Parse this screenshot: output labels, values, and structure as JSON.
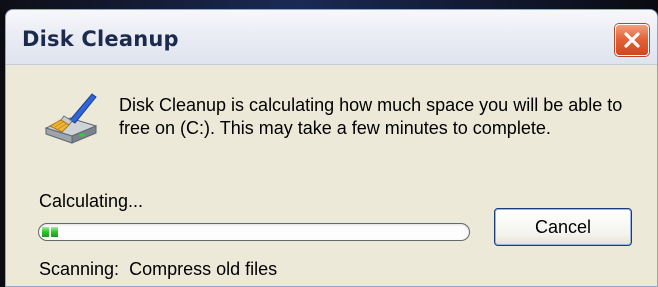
{
  "window": {
    "title": "Disk Cleanup",
    "close_icon": "close-icon"
  },
  "dialog": {
    "icon": "disk-cleanup-brush-icon",
    "message": "Disk Cleanup is calculating how much space you will be able to free on  (C:). This may take a few minutes to complete.",
    "progress_label": "Calculating...",
    "progress_fraction": 0.05,
    "cancel_label": "Cancel",
    "status_prefix": "Scanning:",
    "status_value": "Compress old files"
  },
  "colors": {
    "dialog_background": "#ece9d8",
    "close_button": "#e3643b",
    "progress_fill": "#2fc22c",
    "title_text": "#1b2a4d"
  }
}
